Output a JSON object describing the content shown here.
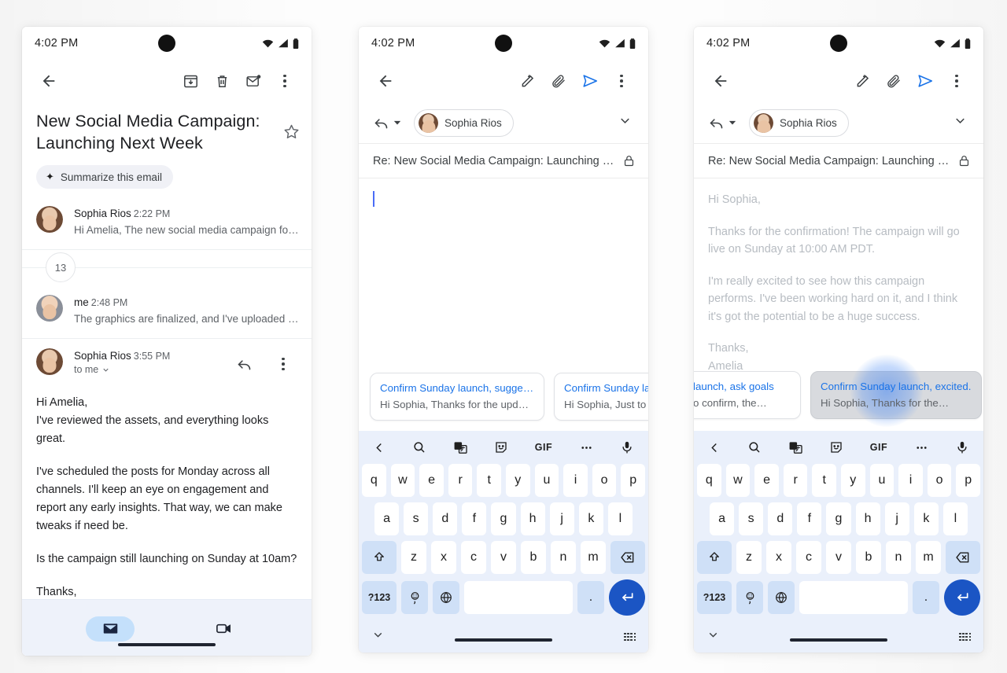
{
  "status_bar": {
    "time": "4:02 PM",
    "icons": [
      "wifi-icon",
      "signal-icon",
      "battery-icon"
    ]
  },
  "colors": {
    "accent_blue": "#1a73e8",
    "enter_key_blue": "#1b55c4",
    "keyboard_bg": "#eaf0fb",
    "key_accent": "#cfe0f7",
    "nav_bg": "#eef2fa",
    "nav_pill_active": "#c4e0fb"
  },
  "phone1": {
    "toolbar": {
      "back": "back-arrow-icon",
      "archive": "archive-icon",
      "delete": "delete-icon",
      "mark_unread": "mark-unread-icon",
      "more": "more-options-icon"
    },
    "subject": "New Social Media Campaign: Launching Next Week",
    "star": "star-outline-icon",
    "summarize_chip": {
      "label": "Summarize this email",
      "icon": "sparkle-icon"
    },
    "messages": [
      {
        "sender": "Sophia Rios",
        "time": "2:22 PM",
        "snippet": "Hi Amelia, The new social media campaign for ou…"
      }
    ],
    "collapsed_count": "13",
    "messages_after": [
      {
        "sender": "me",
        "time": "2:48 PM",
        "snippet": "The graphics are finalized, and I've uploaded the…"
      }
    ],
    "open_message": {
      "sender": "Sophia Rios",
      "time": "3:55 PM",
      "recipients": "to me",
      "reply_icon": "reply-icon",
      "more_icon": "more-options-icon",
      "body": [
        "Hi Amelia,\nI've reviewed the assets, and everything looks great.",
        "I've scheduled the posts for Monday across all channels. I'll keep an eye on engagement and report any early insights. That way, we can make tweaks if need be.",
        "Is the campaign still launching on Sunday at 10am?",
        "Thanks,\nSophia"
      ]
    },
    "bottom_nav": [
      {
        "name": "mail-tab",
        "icon": "mail-icon",
        "active": true
      },
      {
        "name": "meet-tab",
        "icon": "video-camera-icon",
        "active": false
      }
    ]
  },
  "phone2": {
    "toolbar": {
      "back": "back-arrow-icon",
      "format": "format-pencil-icon",
      "attach": "attachment-icon",
      "send": "send-icon",
      "more": "more-options-icon"
    },
    "recipient": {
      "reply_mode": "reply-icon",
      "dropdown": "caret-down-icon",
      "name": "Sophia Rios",
      "expand": "chevron-down-icon"
    },
    "subject": "Re: New Social Media Campaign: Launching N…",
    "lock_icon": "lock-icon",
    "draft_body": "",
    "suggestions": [
      {
        "title": "Confirm Sunday launch, sugge…",
        "preview": "Hi Sophia, Thanks for the updat…",
        "selected": false
      },
      {
        "title": "Confirm Sunday la",
        "preview": "Hi Sophia, Just to c",
        "selected": false
      }
    ],
    "keyboard": {
      "toolbar": [
        "chevron-left-icon",
        "search-icon",
        "translate-icon",
        "sticker-icon",
        "GIF",
        "more-dots-icon",
        "microphone-icon"
      ],
      "row1": [
        "q",
        "w",
        "e",
        "r",
        "t",
        "y",
        "u",
        "i",
        "o",
        "p"
      ],
      "row2": [
        "a",
        "s",
        "d",
        "f",
        "g",
        "h",
        "j",
        "k",
        "l"
      ],
      "row3": [
        "z",
        "x",
        "c",
        "v",
        "b",
        "n",
        "m"
      ],
      "shift_icon": "shift-icon",
      "backspace_icon": "backspace-icon",
      "num_key": "?123",
      "emoji_key": "emoji-comma-icon",
      "globe_key": "globe-icon",
      "space_key": "",
      "period_key": ".",
      "enter_icon": "enter-icon",
      "hide_icon": "chevron-down-icon",
      "switch_icon": "keyboard-switch-icon"
    }
  },
  "phone3": {
    "toolbar": {
      "back": "back-arrow-icon",
      "format": "format-pencil-icon",
      "attach": "attachment-icon",
      "send": "send-icon",
      "more": "more-options-icon"
    },
    "recipient": {
      "reply_mode": "reply-icon",
      "dropdown": "caret-down-icon",
      "name": "Sophia Rios",
      "expand": "chevron-down-icon"
    },
    "subject": "Re: New Social Media Campaign: Launching N…",
    "lock_icon": "lock-icon",
    "draft_body": [
      "Hi Sophia,",
      "Thanks for the confirmation! The campaign will go live on Sunday at 10:00 AM PDT.",
      "I'm really excited to see how this campaign performs. I've been working hard on it, and I think it's got the potential to be a huge success.",
      "Thanks,\nAmelia"
    ],
    "suggestions": [
      {
        "title": "launch, ask goals",
        "preview": "o confirm, the…",
        "selected": false
      },
      {
        "title": "Confirm Sunday launch, excited.",
        "preview": "Hi Sophia, Thanks for the…",
        "selected": true
      }
    ],
    "keyboard": {
      "toolbar": [
        "chevron-left-icon",
        "search-icon",
        "translate-icon",
        "sticker-icon",
        "GIF",
        "more-dots-icon",
        "microphone-icon"
      ],
      "row1": [
        "q",
        "w",
        "e",
        "r",
        "t",
        "y",
        "u",
        "i",
        "o",
        "p"
      ],
      "row2": [
        "a",
        "s",
        "d",
        "f",
        "g",
        "h",
        "j",
        "k",
        "l"
      ],
      "row3": [
        "z",
        "x",
        "c",
        "v",
        "b",
        "n",
        "m"
      ],
      "shift_icon": "shift-icon",
      "backspace_icon": "backspace-icon",
      "num_key": "?123",
      "emoji_key": "emoji-comma-icon",
      "globe_key": "globe-icon",
      "space_key": "",
      "period_key": ".",
      "enter_icon": "enter-icon",
      "hide_icon": "chevron-down-icon",
      "switch_icon": "keyboard-switch-icon"
    }
  }
}
